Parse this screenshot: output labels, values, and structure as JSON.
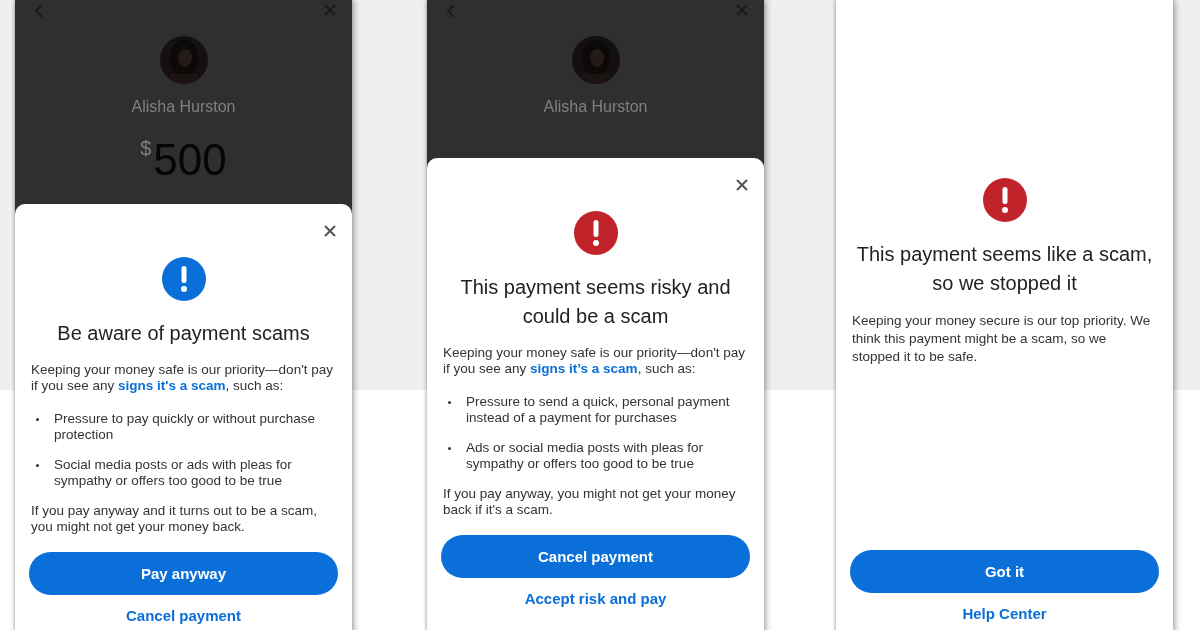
{
  "phones": [
    {
      "kind": "overlay",
      "header": {
        "name": "Alisha Hurston",
        "currency": "$",
        "amount": "500"
      },
      "sheet": {
        "color": "#0a6fd8",
        "title": "Be aware of payment scams",
        "intro": {
          "before": "Keeping your money safe is our priority—don't pay if you see any ",
          "link": "signs it's a scam",
          "after": ", such as:"
        },
        "bullets": [
          "Pressure to pay quickly or without purchase protection",
          "Social media posts or ads with pleas for sympathy or offers too good to be true"
        ],
        "note": "If you pay anyway and it turns out to be a scam, you might not get your money back.",
        "primary": "Pay anyway",
        "secondary": "Cancel payment"
      }
    },
    {
      "kind": "overlay",
      "header": {
        "name": "Alisha Hurston"
      },
      "sheet": {
        "color": "#c1232b",
        "title": "This payment seems risky and could be a scam",
        "intro": {
          "before": "Keeping your money safe is our priority—don't pay if you see any ",
          "link": "signs it’s a scam",
          "after": ", such as:"
        },
        "bullets": [
          "Pressure to send a quick, personal payment instead of a payment for purchases",
          "Ads or social media posts with pleas for sympathy or offers too good to be true"
        ],
        "note": "If you pay anyway, you might not get your money back if it's a scam.",
        "primary": "Cancel payment",
        "secondary": "Accept risk and pay"
      }
    },
    {
      "kind": "full",
      "sheet": {
        "color": "#c1232b",
        "title": "This payment seems like a scam, so we stopped it",
        "body": "Keeping your money secure is our top priority. We think this payment might be a scam, so we stopped it to be safe.",
        "primary": "Got it",
        "secondary": "Help Center"
      }
    }
  ]
}
